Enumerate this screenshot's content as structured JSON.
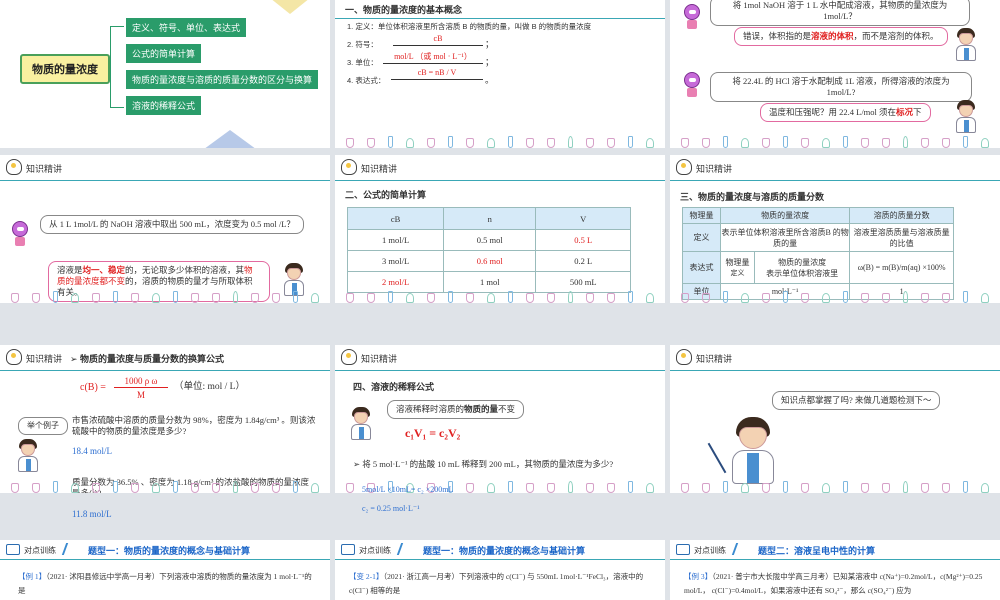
{
  "s1": {
    "center": "物质的量浓度",
    "branches": [
      "定义、符号、单位、表达式",
      "公式的简单计算",
      "物质的量浓度与溶质的质量分数的区分与换算",
      "溶液的稀释公式"
    ]
  },
  "s2": {
    "heading": "一、物质的量浓度的基本概念",
    "l1": "1. 定义：单位体积溶液里所含溶质 B 的物质的量，叫做 B 的物质的量浓度",
    "l2_label": "2. 符号：",
    "l2_val": "cB",
    "l3_label": "3. 单位：",
    "l3_val": "mol/L （或 mol · L⁻¹）",
    "l4_label": "4. 表达式：",
    "l4_val": "cB = nB / V",
    "semi": "；",
    "period": "。"
  },
  "s3": {
    "q1": "将 1mol NaOH 溶于 1 L 水中配成溶液，其物质的量浓度为 1mol/L？",
    "a1_pre": "错误，体积指的是",
    "a1_red": "溶液的体积",
    "a1_post": "，而不是溶剂的体积。",
    "q2": "将 22.4L 的 HCl 溶于水配制成 1L 溶液，所得溶液的浓度为 1mol/L?",
    "a2_pre": "温度和压强呢？用 22.4 L/mol 须在",
    "a2_red": "标况",
    "a2_post": "下"
  },
  "s4": {
    "header": "知识精讲",
    "q": "从 1 L 1mol/L 的 NaOH 溶液中取出 500 mL，浓度变为 0.5 mol /L？",
    "a_pre": "溶液是",
    "a_red1": "均一、稳定",
    "a_mid": "的，无论取多少体积的溶液，其",
    "a_red2": "物质的量浓度都不变",
    "a_post": "的，溶质的物质的量才与所取体积有关。"
  },
  "s5": {
    "header": "知识精讲",
    "heading": "二、公式的简单计算",
    "cols": [
      "cB",
      "n",
      "V"
    ],
    "rows": [
      [
        {
          "v": "1 mol/L",
          "r": false
        },
        {
          "v": "0.5 mol",
          "r": false
        },
        {
          "v": "0.5 L",
          "r": true
        }
      ],
      [
        {
          "v": "3 mol/L",
          "r": false
        },
        {
          "v": "0.6 mol",
          "r": true
        },
        {
          "v": "0.2 L",
          "r": false
        }
      ],
      [
        {
          "v": "2 mol/L",
          "r": true
        },
        {
          "v": "1 mol",
          "r": false
        },
        {
          "v": "500 mL",
          "r": false
        }
      ]
    ]
  },
  "s6": {
    "header": "知识精讲",
    "heading": "三、物质的量浓度与溶质的质量分数",
    "h": [
      "物理量",
      "物质的量浓度",
      "溶质的质量分数"
    ],
    "def_label": "定义",
    "def_c": "表示单位体积溶液里所含溶质B 的物质的量",
    "def_w": "溶液里溶质质量与溶液质量的比值",
    "expr_label": "表达式",
    "expr_c1": "物理量",
    "expr_c2": "物质的量浓度",
    "expr_c3": "表示单位体积溶液里",
    "expr_w": "ω(B) = m(B)/m(aq) ×100%",
    "unit_label": "单位",
    "unit_c": "mol·L⁻¹",
    "unit_w": "1",
    "expr_c4": "定义"
  },
  "s7": {
    "header": "知识精讲",
    "heading": "物质的量浓度与质量分数的换算公式",
    "formula_lhs": "c(B) =",
    "formula_num": "1000 ρ ω",
    "formula_den": "M",
    "formula_unit": "（单位: mol / L）",
    "tag": "举个例子",
    "e1": "市售浓硫酸中溶质的质量分数为 98%，密度为 1.84g/cm³ 。则该浓硫酸中的物质的量浓度是多少?",
    "a1": "18.4 mol/L",
    "e2": "质量分数为 36.5% 、密度为 1.18 g/cm³ 的浓盐酸的物质的量浓度是多少?",
    "a2": "11.8 mol/L"
  },
  "s8": {
    "header": "知识精讲",
    "heading": "四、溶液的稀释公式",
    "bubble_pre": "溶液稀释时溶质的",
    "bubble_bold": "物质的量",
    "bubble_post": "不变",
    "formula": "c₁V₁ = c₂V₂",
    "q": "将 5 mol·L⁻¹ 的盐酸 10 mL 稀释到 200 mL，其物质的量浓度为多少?",
    "a1": "5mol/L ×10mL= c₂ ×200mL",
    "a2": "c₂ = 0.25 mol·L⁻¹"
  },
  "s9": {
    "header": "知识精讲",
    "bubble": "知识点都掌握了吗? 来做几道题检测下～"
  },
  "s10": {
    "l1": "对点训练",
    "l2": "题型一：物质的量浓度的概念与基础计算",
    "tag": "【例 1】",
    "body": "（2021· 沭阳县修远中学高一月考）下列溶液中溶质的物质的量浓度为 1 mol·L⁻¹的是"
  },
  "s11": {
    "l1": "对点训练",
    "l2": "题型一：物质的量浓度的概念与基础计算",
    "tag": "【变 2-1】",
    "body": "（2021· 浙江高一月考）下列溶液中的 c(Cl⁻) 与 550mL 1mol·L⁻¹FeCl₃，溶液中的 c(Cl⁻) 相等的是"
  },
  "s12": {
    "l1": "对点训练",
    "l2": "题型二：溶液呈电中性的计算",
    "tag": "【例 3】",
    "body": "（2021· 普宁市大长陇中学高三月考）已知某溶液中 c(Na⁺)=0.2mol/L，c(Mg²⁺)=0.25 mol/L， c(Cl⁻)=0.4mol/L，如果溶液中还有 SO₄²⁻，那么 c(SO₄²⁻) 应为"
  }
}
